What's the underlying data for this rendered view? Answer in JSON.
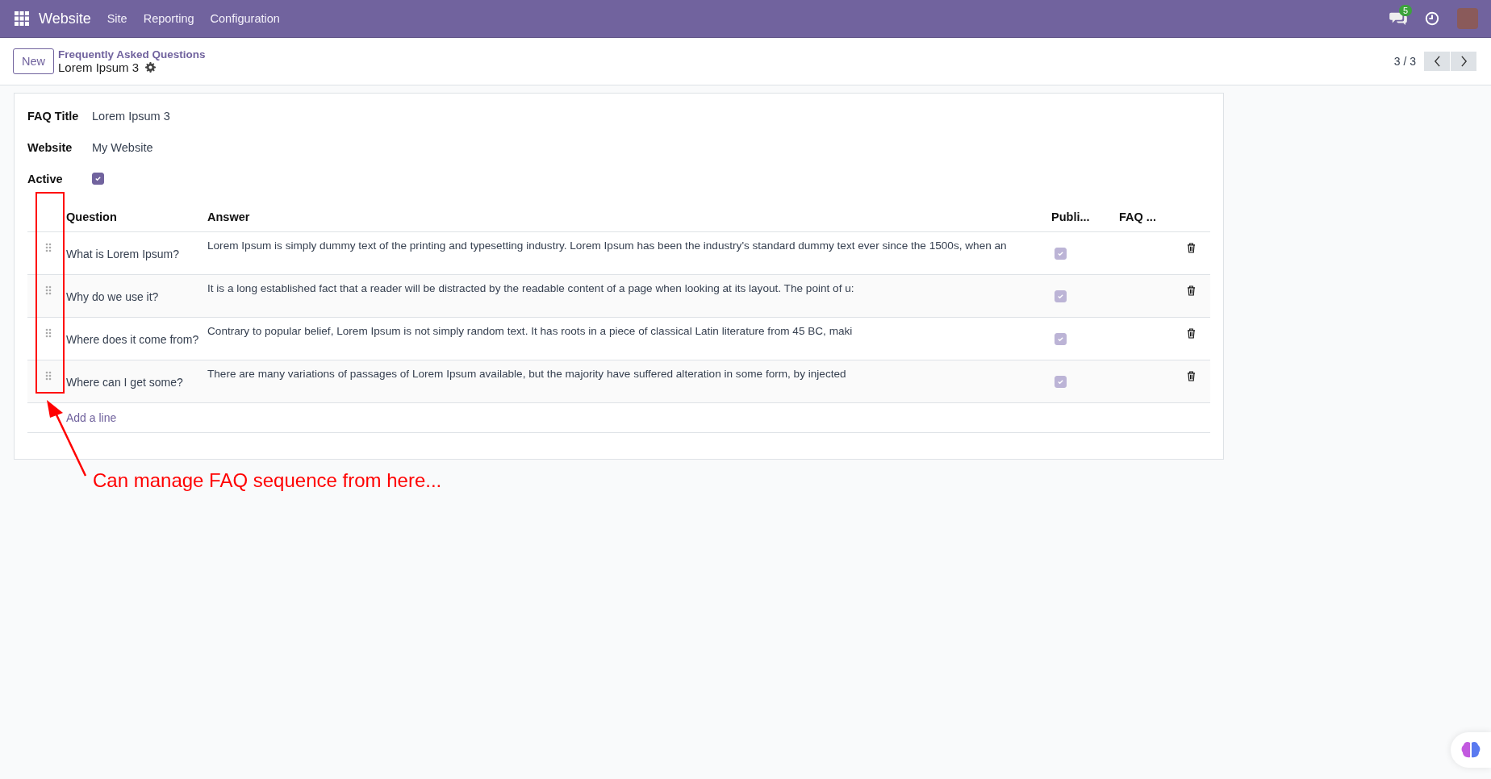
{
  "navbar": {
    "app": "Website",
    "menus": [
      "Site",
      "Reporting",
      "Configuration"
    ],
    "message_count": "5"
  },
  "control_panel": {
    "new_button": "New",
    "breadcrumb": "Frequently Asked Questions",
    "record": "Lorem Ipsum 3",
    "pager": "3 / 3"
  },
  "form": {
    "fields": [
      {
        "label": "FAQ Title",
        "value": "Lorem Ipsum 3"
      },
      {
        "label": "Website",
        "value": "My Website"
      }
    ],
    "active": {
      "label": "Active",
      "checked": true
    },
    "table": {
      "columns": [
        "Question",
        "Answer",
        "Publi...",
        "FAQ ..."
      ],
      "rows": [
        {
          "question": "What is Lorem Ipsum?",
          "answer": "Lorem Ipsum is simply dummy text of the printing and typesetting industry. Lorem Ipsum has been the industry's standard dummy text ever since the 1500s, when an",
          "published": true
        },
        {
          "question": "Why do we use it?",
          "answer": "It is a long established fact that a reader will be distracted by the readable content of a page when looking at its layout. The point of u:",
          "published": true
        },
        {
          "question": "Where does it come from?",
          "answer": "Contrary to popular belief, Lorem Ipsum is not simply random text. It has roots in a piece of classical Latin literature from 45 BC, maki",
          "published": true
        },
        {
          "question": "Where can I get some?",
          "answer": "There are many variations of passages of Lorem Ipsum available, but the majority have suffered alteration in some form, by injected",
          "published": true
        }
      ],
      "add_line": "Add a line"
    }
  },
  "annotation": {
    "text": "Can manage FAQ sequence from here..."
  }
}
